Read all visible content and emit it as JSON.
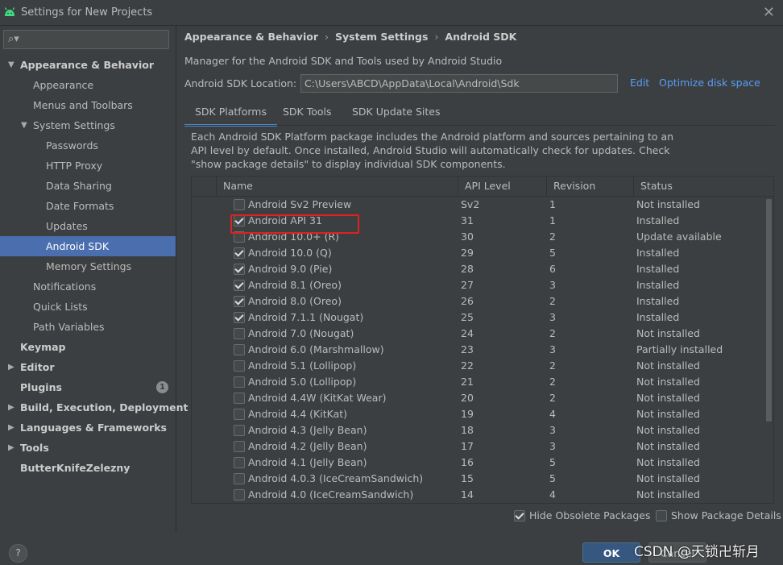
{
  "window": {
    "title": "Settings for New Projects"
  },
  "sidebar": {
    "search_placeholder": "",
    "items": [
      {
        "label": "Appearance & Behavior",
        "level": 0,
        "arrow": "▼"
      },
      {
        "label": "Appearance",
        "level": 1
      },
      {
        "label": "Menus and Toolbars",
        "level": 1
      },
      {
        "label": "System Settings",
        "level": 1,
        "arrow": "▼"
      },
      {
        "label": "Passwords",
        "level": 2
      },
      {
        "label": "HTTP Proxy",
        "level": 2
      },
      {
        "label": "Data Sharing",
        "level": 2
      },
      {
        "label": "Date Formats",
        "level": 2
      },
      {
        "label": "Updates",
        "level": 2
      },
      {
        "label": "Android SDK",
        "level": 2,
        "selected": true
      },
      {
        "label": "Memory Settings",
        "level": 2
      },
      {
        "label": "Notifications",
        "level": 1
      },
      {
        "label": "Quick Lists",
        "level": 1
      },
      {
        "label": "Path Variables",
        "level": 1
      },
      {
        "label": "Keymap",
        "level": 0
      },
      {
        "label": "Editor",
        "level": 0,
        "arrow": "▶"
      },
      {
        "label": "Plugins",
        "level": 0,
        "badge": "1"
      },
      {
        "label": "Build, Execution, Deployment",
        "level": 0,
        "arrow": "▶"
      },
      {
        "label": "Languages & Frameworks",
        "level": 0,
        "arrow": "▶"
      },
      {
        "label": "Tools",
        "level": 0,
        "arrow": "▶"
      },
      {
        "label": "ButterKnifeZelezny",
        "level": 0
      }
    ]
  },
  "main": {
    "breadcrumb": [
      "Appearance & Behavior",
      "System Settings",
      "Android SDK"
    ],
    "breadcrumb_sep": "›",
    "description": "Manager for the Android SDK and Tools used by Android Studio",
    "sdk_location_label": "Android SDK Location:",
    "sdk_location_value": "C:\\Users\\ABCD\\AppData\\Local\\Android\\Sdk",
    "edit_link": "Edit",
    "optimize_link": "Optimize disk space",
    "tabs": [
      {
        "label": "SDK Platforms",
        "active": true
      },
      {
        "label": "SDK Tools"
      },
      {
        "label": "SDK Update Sites"
      }
    ],
    "platform_description": "Each Android SDK Platform package includes the Android platform and sources pertaining to an API level by default. Once installed, Android Studio will automatically check for updates. Check \"show package details\" to display individual SDK components.",
    "table": {
      "columns": [
        "Name",
        "API Level",
        "Revision",
        "Status"
      ],
      "rows": [
        {
          "checked": false,
          "name": "Android Sv2 Preview",
          "api": "Sv2",
          "rev": "1",
          "status": "Not installed"
        },
        {
          "checked": true,
          "name": "Android API 31",
          "api": "31",
          "rev": "1",
          "status": "Installed",
          "highlighted": true
        },
        {
          "checked": false,
          "name": "Android 10.0+ (R)",
          "api": "30",
          "rev": "2",
          "status": "Update available"
        },
        {
          "checked": true,
          "name": "Android 10.0 (Q)",
          "api": "29",
          "rev": "5",
          "status": "Installed"
        },
        {
          "checked": true,
          "name": "Android 9.0 (Pie)",
          "api": "28",
          "rev": "6",
          "status": "Installed"
        },
        {
          "checked": true,
          "name": "Android 8.1 (Oreo)",
          "api": "27",
          "rev": "3",
          "status": "Installed"
        },
        {
          "checked": true,
          "name": "Android 8.0 (Oreo)",
          "api": "26",
          "rev": "2",
          "status": "Installed"
        },
        {
          "checked": true,
          "name": "Android 7.1.1 (Nougat)",
          "api": "25",
          "rev": "3",
          "status": "Installed"
        },
        {
          "checked": false,
          "name": "Android 7.0 (Nougat)",
          "api": "24",
          "rev": "2",
          "status": "Not installed"
        },
        {
          "checked": false,
          "name": "Android 6.0 (Marshmallow)",
          "api": "23",
          "rev": "3",
          "status": "Partially installed"
        },
        {
          "checked": false,
          "name": "Android 5.1 (Lollipop)",
          "api": "22",
          "rev": "2",
          "status": "Not installed"
        },
        {
          "checked": false,
          "name": "Android 5.0 (Lollipop)",
          "api": "21",
          "rev": "2",
          "status": "Not installed"
        },
        {
          "checked": false,
          "name": "Android 4.4W (KitKat Wear)",
          "api": "20",
          "rev": "2",
          "status": "Not installed"
        },
        {
          "checked": false,
          "name": "Android 4.4 (KitKat)",
          "api": "19",
          "rev": "4",
          "status": "Not installed"
        },
        {
          "checked": false,
          "name": "Android 4.3 (Jelly Bean)",
          "api": "18",
          "rev": "3",
          "status": "Not installed"
        },
        {
          "checked": false,
          "name": "Android 4.2 (Jelly Bean)",
          "api": "17",
          "rev": "3",
          "status": "Not installed"
        },
        {
          "checked": false,
          "name": "Android 4.1 (Jelly Bean)",
          "api": "16",
          "rev": "5",
          "status": "Not installed"
        },
        {
          "checked": false,
          "name": "Android 4.0.3 (IceCreamSandwich)",
          "api": "15",
          "rev": "5",
          "status": "Not installed"
        },
        {
          "checked": false,
          "name": "Android 4.0 (IceCreamSandwich)",
          "api": "14",
          "rev": "4",
          "status": "Not installed"
        }
      ]
    },
    "hide_obsolete": {
      "label": "Hide Obsolete Packages",
      "checked": true
    },
    "show_details": {
      "label": "Show Package Details",
      "checked": false
    }
  },
  "footer": {
    "help": "?",
    "ok": "OK",
    "cancel": "Cancel",
    "watermark": "CSDN @天锁卍斩月"
  },
  "colors": {
    "background": "#3c3f41",
    "selection": "#4b6eaf",
    "link": "#589df6",
    "highlight_box": "#e2211c",
    "ok_button": "#365880"
  }
}
